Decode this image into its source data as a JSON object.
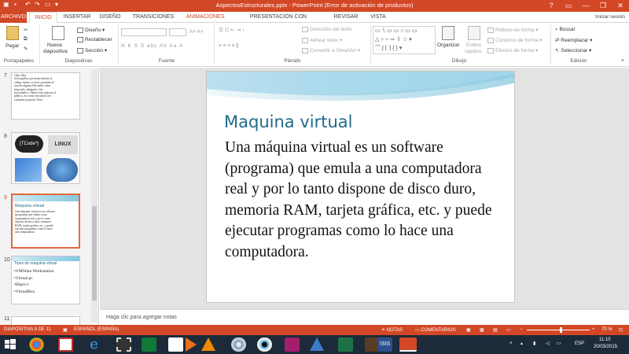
{
  "window": {
    "title": "AspectosEstructurales.pptx - PowerPoint (Error de activación de productos)",
    "help": "?",
    "minimize": "—",
    "restore": "❐",
    "close": "✕",
    "sign_in": "Iniciar sesión"
  },
  "tabs": [
    "ARCHIVO",
    "INICIO",
    "INSERTAR",
    "DISEÑO",
    "TRANSICIONES",
    "ANIMACIONES",
    "PRESENTACIÓN CON DIAPOSITIVAS",
    "REVISAR",
    "VISTA"
  ],
  "ribbon": {
    "clipboard": {
      "paste": "Pegar",
      "label": "Portapapeles"
    },
    "slides": {
      "new_slide": "Nueva",
      "new_slide2": "diapositiva",
      "layout": "Diseño",
      "reset": "Restablecer",
      "section": "Sección",
      "label": "Diapositivas"
    },
    "font": {
      "label": "Fuente",
      "format_buttons": "N  K  S  S  abc  AV   Aa   A"
    },
    "paragraph": {
      "text_direction": "Dirección del texto",
      "align_text": "Alinear texto",
      "smartart": "Convertir a SmartArt",
      "label": "Párrafo"
    },
    "drawing": {
      "arrange": "Organizar",
      "quick_styles": "Estilos",
      "quick_styles2": "rápidos",
      "shape_fill": "Relleno de forma",
      "shape_outline": "Contorno de forma",
      "shape_effects": "Efectos de forma",
      "label": "Dibujo"
    },
    "editing": {
      "find": "Buscar",
      "replace": "Reemplazar",
      "select": "Seleccionar",
      "label": "Edición"
    }
  },
  "thumbnails": [
    {
      "num": "7",
      "lines": [
        "•Tipo libre",
        "Son aquellas que tienen abierto el",
        "código fuente, es decir, permiten al",
        "usuario algunas libertades como",
        "mejorarlo, adaptarlo a las",
        "necesidades y liberar esas mejoras al",
        "público, así como ejecutarlo con",
        "cualquier propósito lícito."
      ]
    },
    {
      "num": "8",
      "labels": [
        "{TCode*}",
        "LINUX"
      ]
    },
    {
      "num": "9",
      "title": "Maquina virtual",
      "lines": [
        "Una máquina virtual es un software",
        "(programa) que emula a una",
        "computadora real y por lo tanto",
        "dispone de disco duro, memoria",
        "RAM, tarjeta gráfica, etc. y puede",
        "ejecutar programas como lo hace",
        "una computadora."
      ]
    },
    {
      "num": "10",
      "title": "Tipos de maquina virtual",
      "lines": [
        "•VMWare Workstation",
        "•Virtual pc",
        "•Hiper-v",
        "•VirtualBox"
      ]
    },
    {
      "num": "11"
    }
  ],
  "slide": {
    "title": "Maquina virtual",
    "body": "Una máquina virtual es un software (programa) que emula a una computadora real y por lo tanto dispone de disco duro, memoria RAM, tarjeta gráfica, etc. y puede ejecutar programas como lo hace una computadora."
  },
  "notes_placeholder": "Haga clic para agregar notas",
  "status": {
    "slide_info": "DIAPOSITIVA 9 DE 11",
    "language": "ESPAÑOL (ESPAÑA)",
    "notes": "NOTAS",
    "comments": "COMENTARIOS",
    "zoom": "70 %",
    "zoom_level": 0.7
  },
  "taskbar": {
    "lang": "ESP",
    "time": "11:10",
    "date": "20/03/2015",
    "apps": [
      "start-icon",
      "folder-icon",
      "chrome-icon",
      "clapper-icon",
      "ie-icon",
      "film-icon",
      "store-icon",
      "media-player-icon",
      "vlc-icon",
      "cd-icon",
      "eye-icon",
      "camera-app-icon",
      "vm-icon",
      "excel-icon",
      "game-icon",
      "isis-icon",
      "powerpoint-icon"
    ]
  },
  "colors": {
    "accent": "#d24726",
    "title": "#1e6b8a",
    "taskbar": "#1d2a3a"
  }
}
